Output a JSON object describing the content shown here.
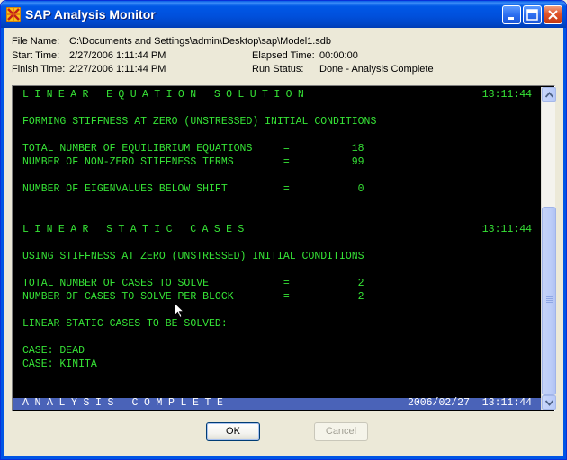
{
  "window": {
    "title": "SAP Analysis Monitor"
  },
  "info": {
    "file_name_label": "File Name:",
    "file_name_value": "C:\\Documents and Settings\\admin\\Desktop\\sap\\Model1.sdb",
    "start_time_label": "Start Time:",
    "start_time_value": "2/27/2006 1:11:44 PM",
    "finish_time_label": "Finish Time:",
    "finish_time_value": "2/27/2006 1:11:44 PM",
    "elapsed_time_label": "Elapsed Time:",
    "elapsed_time_value": "00:00:00",
    "run_status_label": "Run Status:",
    "run_status_value": "Done - Analysis Complete"
  },
  "console": {
    "lines": [
      {
        "text": "LINEAR EQUATION SOLUTION",
        "time": "13:11:44"
      },
      {
        "text": "FORMING STIFFNESS AT ZERO (UNSTRESSED) INITIAL CONDITIONS"
      },
      {
        "text": "TOTAL NUMBER OF EQUILIBRIUM EQUATIONS     =          18"
      },
      {
        "text": "NUMBER OF NON-ZERO STIFFNESS TERMS        =          99"
      },
      {
        "text": "NUMBER OF EIGENVALUES BELOW SHIFT         =           0"
      },
      {
        "text": "LINEAR STATIC CASES",
        "time": "13:11:44"
      },
      {
        "text": "USING STIFFNESS AT ZERO (UNSTRESSED) INITIAL CONDITIONS"
      },
      {
        "text": "TOTAL NUMBER OF CASES TO SOLVE            =           2"
      },
      {
        "text": "NUMBER OF CASES TO SOLVE PER BLOCK        =           2"
      },
      {
        "text": "LINEAR STATIC CASES TO BE SOLVED:"
      },
      {
        "text": "CASE: DEAD"
      },
      {
        "text": "CASE: KINITA"
      }
    ],
    "status": {
      "text": "ANALYSIS COMPLETE",
      "date": "2006/02/27",
      "time": "13:11:44"
    }
  },
  "buttons": {
    "ok_label": "OK",
    "cancel_label": "Cancel"
  },
  "colors": {
    "console_bg": "#000000",
    "console_text": "#36e336",
    "status_bar": "#4a63b8",
    "title_bar": "#0050dc"
  },
  "icons": [
    "sap-app-icon",
    "minimize-icon",
    "maximize-icon",
    "close-icon",
    "scroll-up-icon",
    "scroll-down-icon",
    "mouse-cursor-icon"
  ]
}
